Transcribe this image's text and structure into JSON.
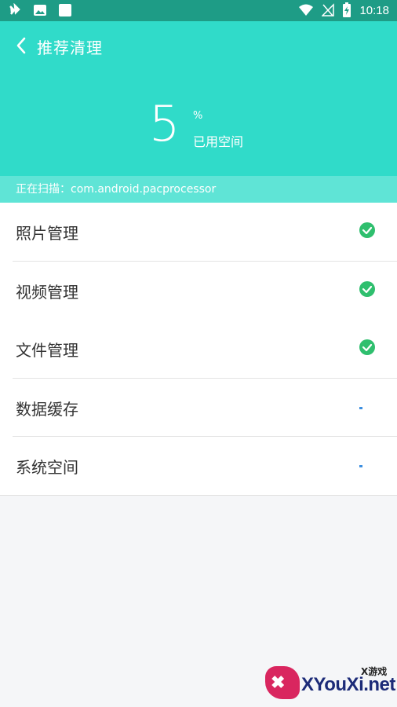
{
  "status_bar": {
    "time": "10:18",
    "icons_left": [
      "bug-icon",
      "image-icon",
      "notification-square-icon"
    ],
    "icons_right": [
      "wifi-icon",
      "no-signal-icon",
      "battery-charging-icon"
    ]
  },
  "header": {
    "title": "推荐清理",
    "back_icon": "chevron-left-icon"
  },
  "usage": {
    "percent_value": "5",
    "percent_sign": "%",
    "label": "已用空间"
  },
  "scan": {
    "text": "正在扫描：com.android.pacprocessor"
  },
  "items": [
    {
      "label": "照片管理",
      "status": "done"
    },
    {
      "label": "视频管理",
      "status": "done"
    },
    {
      "label": "文件管理",
      "status": "done"
    },
    {
      "label": "数据缓存",
      "status": "scanning"
    },
    {
      "label": "系统空间",
      "status": "scanning"
    }
  ],
  "watermark": {
    "top_text": "X游戏",
    "brand": "XYouXi.net"
  },
  "colors": {
    "status_bar": "#1e9c86",
    "hero": "#30dbc9",
    "scan_bar": "#5fe4d6",
    "check": "#2fbf6e",
    "pending": "#3d8fe0"
  }
}
